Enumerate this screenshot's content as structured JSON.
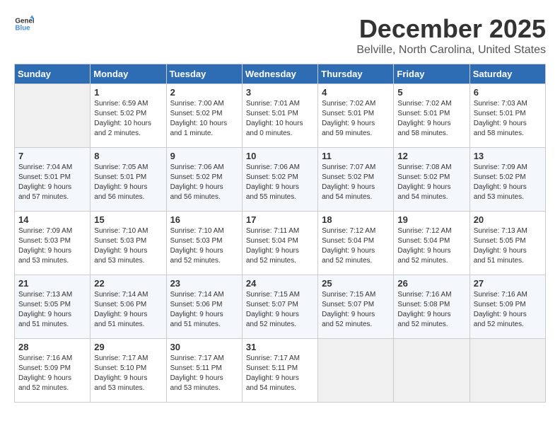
{
  "header": {
    "logo_line1": "General",
    "logo_line2": "Blue",
    "title": "December 2025",
    "subtitle": "Belville, North Carolina, United States"
  },
  "columns": [
    "Sunday",
    "Monday",
    "Tuesday",
    "Wednesday",
    "Thursday",
    "Friday",
    "Saturday"
  ],
  "weeks": [
    [
      {
        "day": "",
        "content": ""
      },
      {
        "day": "1",
        "content": "Sunrise: 6:59 AM\nSunset: 5:02 PM\nDaylight: 10 hours\nand 2 minutes."
      },
      {
        "day": "2",
        "content": "Sunrise: 7:00 AM\nSunset: 5:02 PM\nDaylight: 10 hours\nand 1 minute."
      },
      {
        "day": "3",
        "content": "Sunrise: 7:01 AM\nSunset: 5:01 PM\nDaylight: 10 hours\nand 0 minutes."
      },
      {
        "day": "4",
        "content": "Sunrise: 7:02 AM\nSunset: 5:01 PM\nDaylight: 9 hours\nand 59 minutes."
      },
      {
        "day": "5",
        "content": "Sunrise: 7:02 AM\nSunset: 5:01 PM\nDaylight: 9 hours\nand 58 minutes."
      },
      {
        "day": "6",
        "content": "Sunrise: 7:03 AM\nSunset: 5:01 PM\nDaylight: 9 hours\nand 58 minutes."
      }
    ],
    [
      {
        "day": "7",
        "content": "Sunrise: 7:04 AM\nSunset: 5:01 PM\nDaylight: 9 hours\nand 57 minutes."
      },
      {
        "day": "8",
        "content": "Sunrise: 7:05 AM\nSunset: 5:01 PM\nDaylight: 9 hours\nand 56 minutes."
      },
      {
        "day": "9",
        "content": "Sunrise: 7:06 AM\nSunset: 5:02 PM\nDaylight: 9 hours\nand 56 minutes."
      },
      {
        "day": "10",
        "content": "Sunrise: 7:06 AM\nSunset: 5:02 PM\nDaylight: 9 hours\nand 55 minutes."
      },
      {
        "day": "11",
        "content": "Sunrise: 7:07 AM\nSunset: 5:02 PM\nDaylight: 9 hours\nand 54 minutes."
      },
      {
        "day": "12",
        "content": "Sunrise: 7:08 AM\nSunset: 5:02 PM\nDaylight: 9 hours\nand 54 minutes."
      },
      {
        "day": "13",
        "content": "Sunrise: 7:09 AM\nSunset: 5:02 PM\nDaylight: 9 hours\nand 53 minutes."
      }
    ],
    [
      {
        "day": "14",
        "content": "Sunrise: 7:09 AM\nSunset: 5:03 PM\nDaylight: 9 hours\nand 53 minutes."
      },
      {
        "day": "15",
        "content": "Sunrise: 7:10 AM\nSunset: 5:03 PM\nDaylight: 9 hours\nand 53 minutes."
      },
      {
        "day": "16",
        "content": "Sunrise: 7:10 AM\nSunset: 5:03 PM\nDaylight: 9 hours\nand 52 minutes."
      },
      {
        "day": "17",
        "content": "Sunrise: 7:11 AM\nSunset: 5:04 PM\nDaylight: 9 hours\nand 52 minutes."
      },
      {
        "day": "18",
        "content": "Sunrise: 7:12 AM\nSunset: 5:04 PM\nDaylight: 9 hours\nand 52 minutes."
      },
      {
        "day": "19",
        "content": "Sunrise: 7:12 AM\nSunset: 5:04 PM\nDaylight: 9 hours\nand 52 minutes."
      },
      {
        "day": "20",
        "content": "Sunrise: 7:13 AM\nSunset: 5:05 PM\nDaylight: 9 hours\nand 51 minutes."
      }
    ],
    [
      {
        "day": "21",
        "content": "Sunrise: 7:13 AM\nSunset: 5:05 PM\nDaylight: 9 hours\nand 51 minutes."
      },
      {
        "day": "22",
        "content": "Sunrise: 7:14 AM\nSunset: 5:06 PM\nDaylight: 9 hours\nand 51 minutes."
      },
      {
        "day": "23",
        "content": "Sunrise: 7:14 AM\nSunset: 5:06 PM\nDaylight: 9 hours\nand 51 minutes."
      },
      {
        "day": "24",
        "content": "Sunrise: 7:15 AM\nSunset: 5:07 PM\nDaylight: 9 hours\nand 52 minutes."
      },
      {
        "day": "25",
        "content": "Sunrise: 7:15 AM\nSunset: 5:07 PM\nDaylight: 9 hours\nand 52 minutes."
      },
      {
        "day": "26",
        "content": "Sunrise: 7:16 AM\nSunset: 5:08 PM\nDaylight: 9 hours\nand 52 minutes."
      },
      {
        "day": "27",
        "content": "Sunrise: 7:16 AM\nSunset: 5:09 PM\nDaylight: 9 hours\nand 52 minutes."
      }
    ],
    [
      {
        "day": "28",
        "content": "Sunrise: 7:16 AM\nSunset: 5:09 PM\nDaylight: 9 hours\nand 52 minutes."
      },
      {
        "day": "29",
        "content": "Sunrise: 7:17 AM\nSunset: 5:10 PM\nDaylight: 9 hours\nand 53 minutes."
      },
      {
        "day": "30",
        "content": "Sunrise: 7:17 AM\nSunset: 5:11 PM\nDaylight: 9 hours\nand 53 minutes."
      },
      {
        "day": "31",
        "content": "Sunrise: 7:17 AM\nSunset: 5:11 PM\nDaylight: 9 hours\nand 54 minutes."
      },
      {
        "day": "",
        "content": ""
      },
      {
        "day": "",
        "content": ""
      },
      {
        "day": "",
        "content": ""
      }
    ]
  ]
}
